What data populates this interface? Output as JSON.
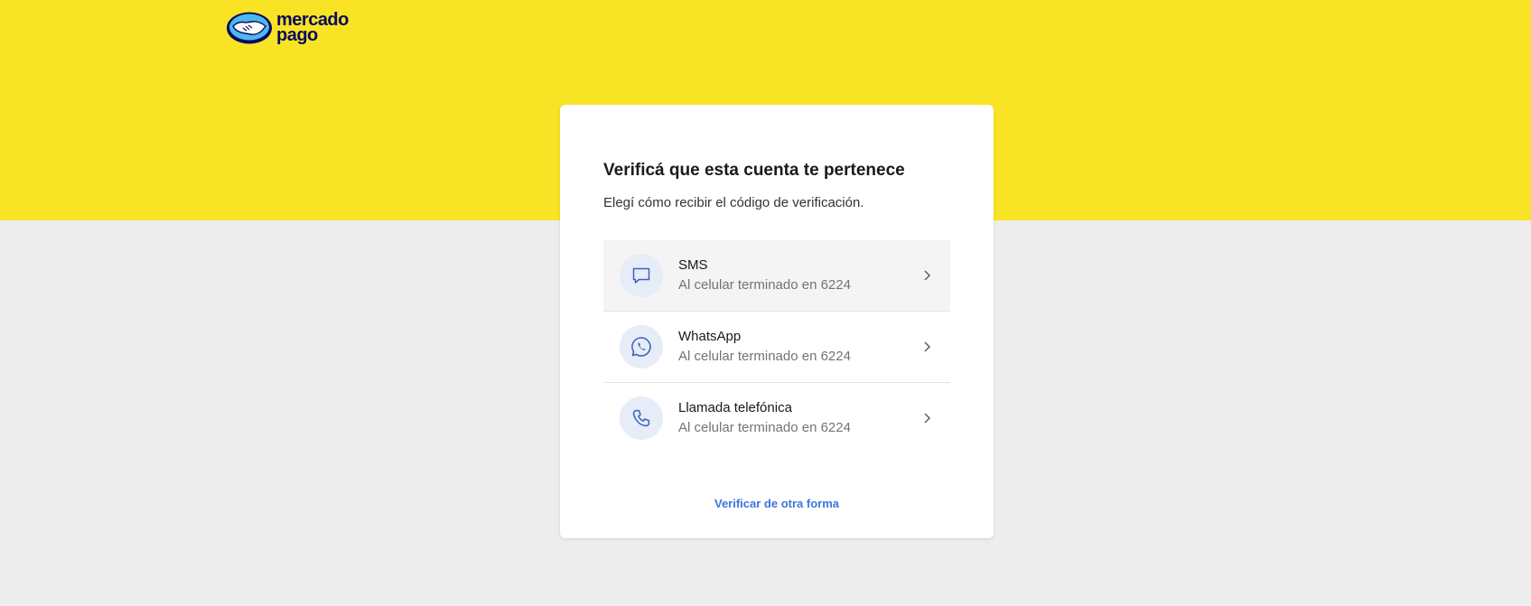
{
  "brand": {
    "name_line1": "mercado",
    "name_line2": "pago",
    "logo_icon": "handshake-icon",
    "colors": {
      "header_yellow": "#f8e424",
      "page_background": "#ededed",
      "link_blue": "#3c75dd",
      "icon_background": "#e6ecf8"
    }
  },
  "verification": {
    "title": "Verificá que esta cuenta te pertenece",
    "subtitle": "Elegí cómo recibir el código de verificación.",
    "options": [
      {
        "title": "SMS",
        "description": "Al celular terminado en 6224",
        "icon": "message-icon"
      },
      {
        "title": "WhatsApp",
        "description": "Al celular terminado en 6224",
        "icon": "whatsapp-icon"
      },
      {
        "title": "Llamada telefónica",
        "description": "Al celular terminado en 6224",
        "icon": "phone-icon"
      }
    ],
    "alternative_link": "Verificar de otra forma"
  }
}
